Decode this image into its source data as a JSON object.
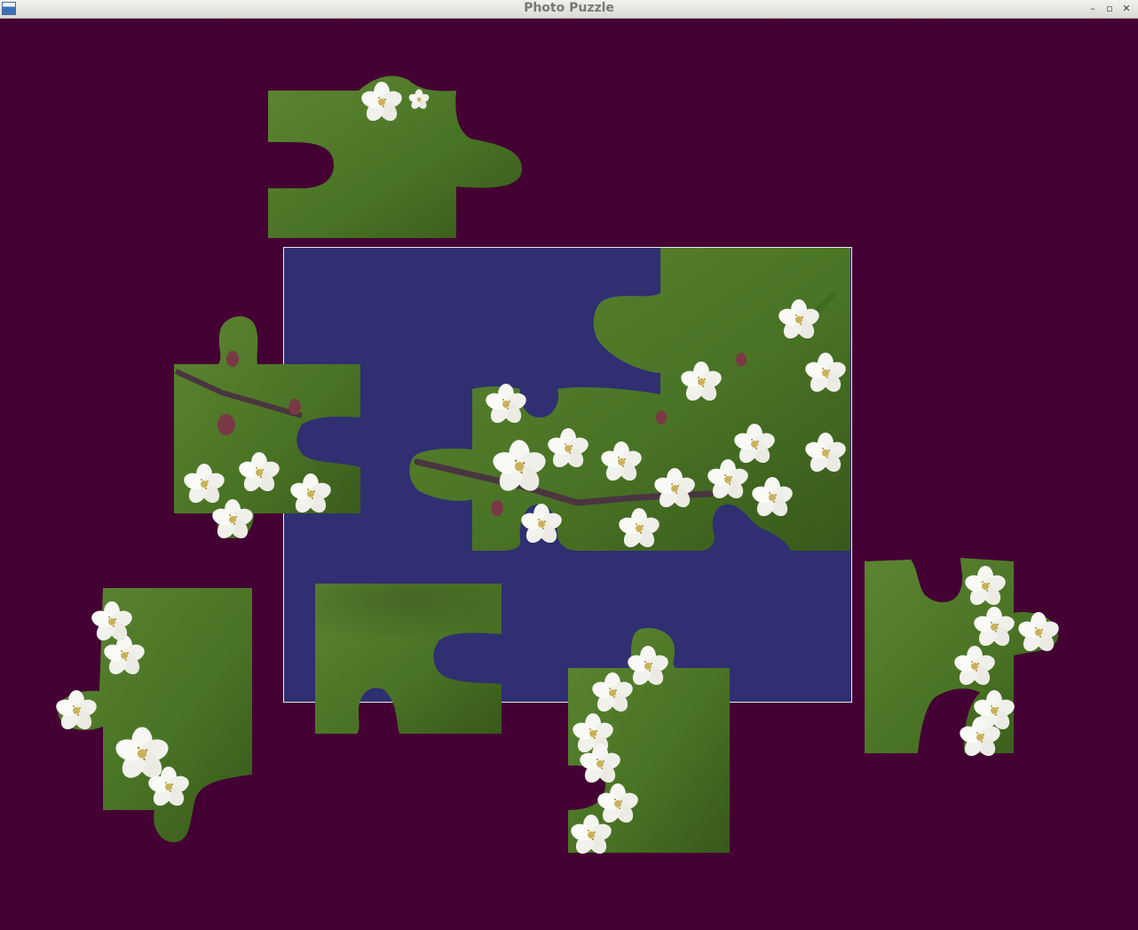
{
  "window": {
    "title": "Photo Puzzle",
    "icon": "app-window-icon",
    "controls": [
      {
        "name": "minimize-button",
        "glyph": "–"
      },
      {
        "name": "maximize-button",
        "glyph": "▫"
      },
      {
        "name": "close-button",
        "glyph": "✕"
      }
    ]
  },
  "colors": {
    "background": "#440033",
    "board": "#2f2f72",
    "board_border": "#e8e8f0",
    "grass": "#4f7a2a",
    "grass_dark": "#37581b",
    "blossom": "#f4f4f0",
    "branch": "#4a3540"
  },
  "puzzle": {
    "board": "empty-board-area",
    "loose_pieces": 6,
    "placed_region": "placed-pieces-image"
  }
}
